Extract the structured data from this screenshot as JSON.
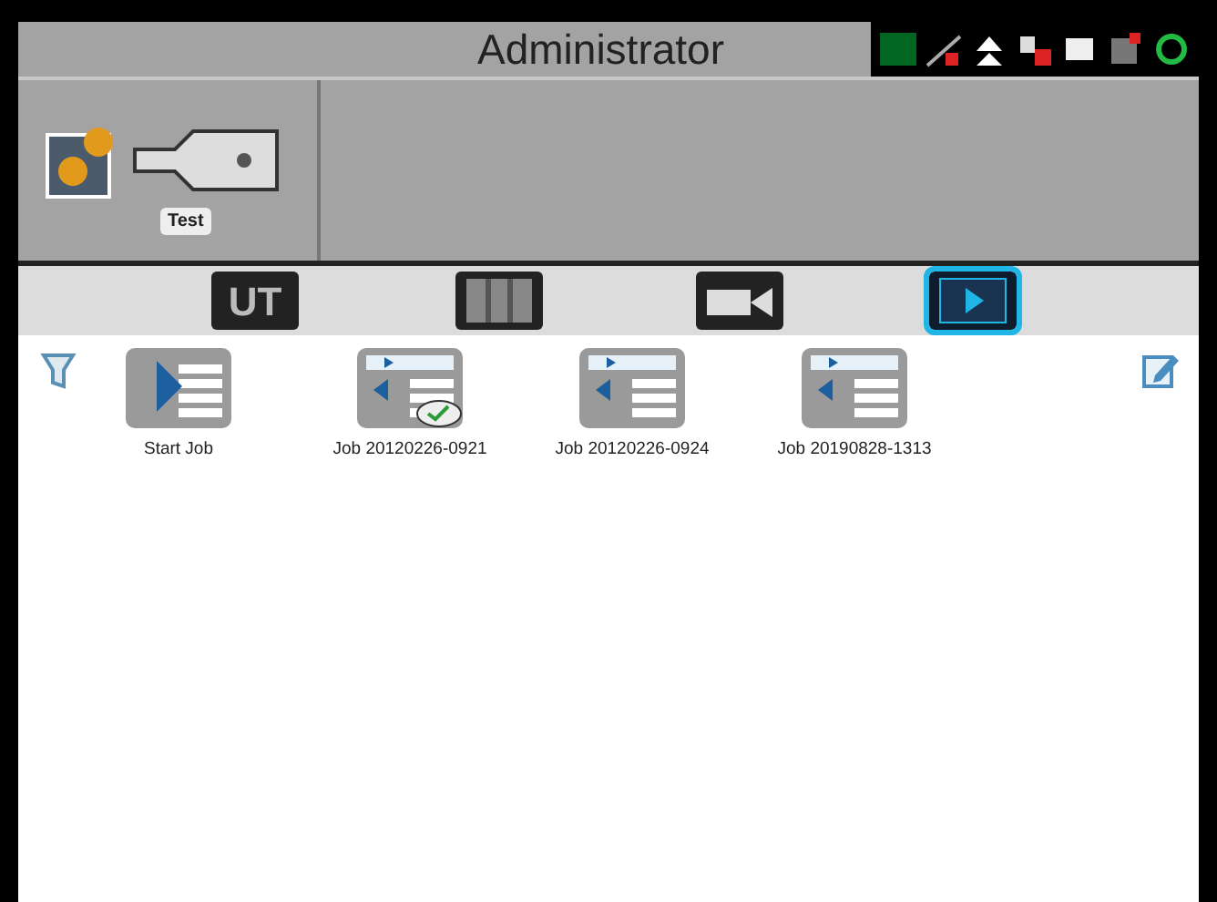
{
  "title": "Administrator",
  "profile": {
    "label": "Test"
  },
  "tabs": [
    {
      "kind": "ut",
      "label": "UT",
      "selected": false
    },
    {
      "kind": "map",
      "selected": false
    },
    {
      "kind": "camera",
      "selected": false
    },
    {
      "kind": "jobs",
      "selected": true
    }
  ],
  "jobs": [
    {
      "kind": "start",
      "label": "Start Job",
      "synced": false
    },
    {
      "kind": "job",
      "label": "Job 20120226-0921",
      "synced": true
    },
    {
      "kind": "job",
      "label": "Job 20120226-0924",
      "synced": false
    },
    {
      "kind": "job",
      "label": "Job 20190828-1313",
      "synced": false
    }
  ]
}
